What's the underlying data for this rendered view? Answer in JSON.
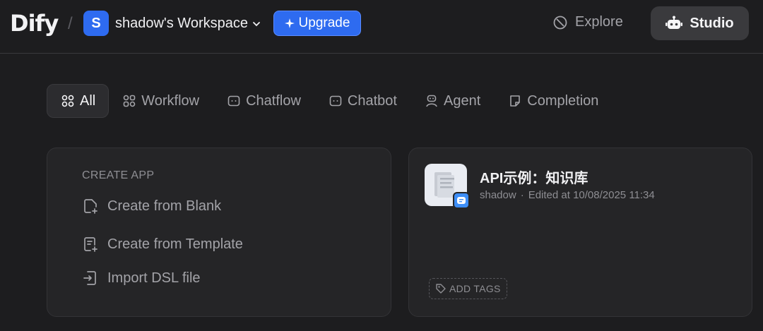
{
  "header": {
    "logo": "Dify",
    "separator": "/",
    "workspace": {
      "avatar_letter": "S",
      "name": "shadow's Workspace"
    },
    "upgrade_label": "Upgrade",
    "explore_label": "Explore",
    "studio_label": "Studio"
  },
  "tabs": [
    {
      "label": "All",
      "icon": "grid-icon",
      "active": true
    },
    {
      "label": "Workflow",
      "icon": "workflow-icon"
    },
    {
      "label": "Chatflow",
      "icon": "chatflow-icon"
    },
    {
      "label": "Chatbot",
      "icon": "chatbot-icon"
    },
    {
      "label": "Agent",
      "icon": "agent-icon"
    },
    {
      "label": "Completion",
      "icon": "completion-icon"
    }
  ],
  "create_app": {
    "title": "CREATE APP",
    "items": [
      {
        "label": "Create from Blank",
        "icon": "file-plus-icon"
      },
      {
        "label": "Create from Template",
        "icon": "file-template-icon"
      },
      {
        "label": "Import DSL file",
        "icon": "import-icon"
      }
    ]
  },
  "app_card": {
    "title": "API示例：知识库",
    "author": "shadow",
    "dot": "·",
    "edited": "Edited at 10/08/2025 11:34",
    "add_tags_label": "ADD TAGS"
  },
  "colors": {
    "accent": "#2e6bf0",
    "background": "#1d1d1f",
    "card": "#252527"
  }
}
